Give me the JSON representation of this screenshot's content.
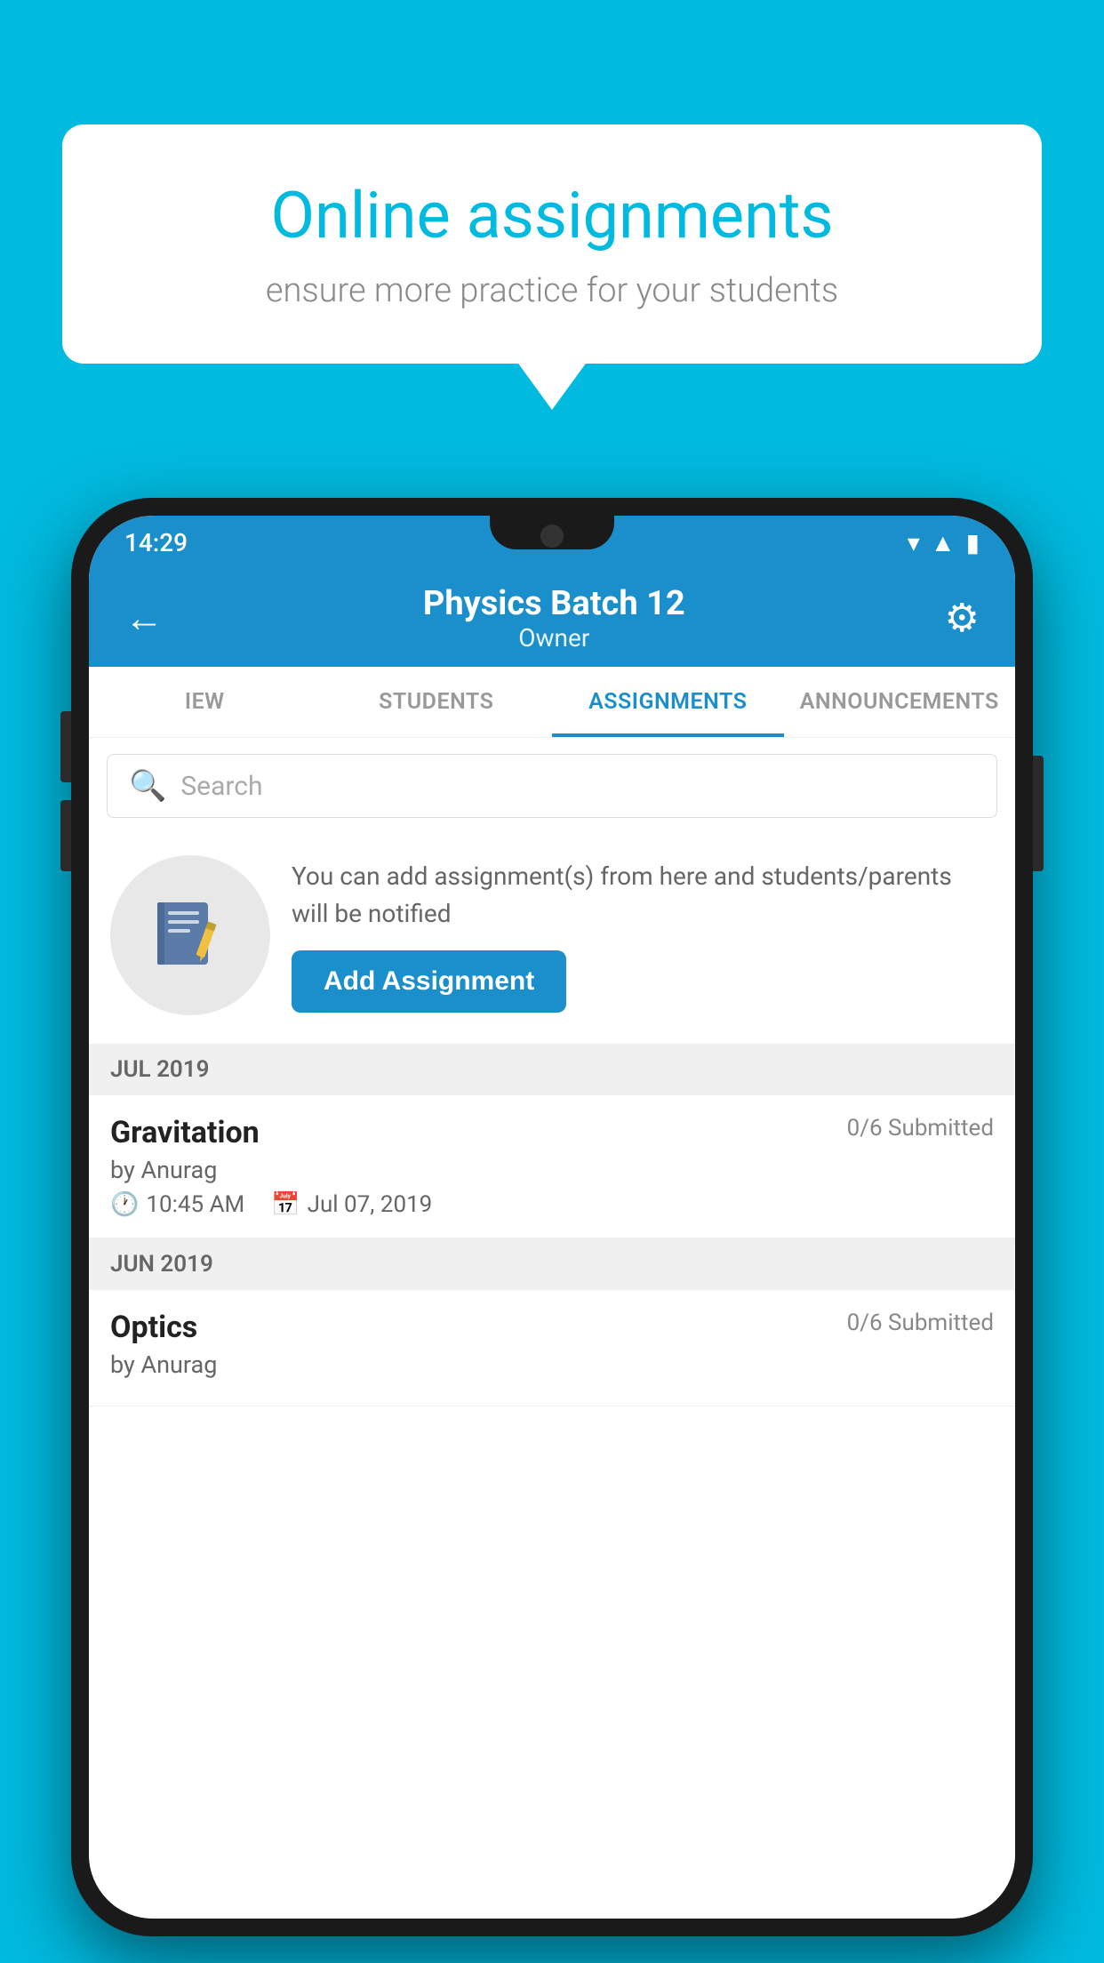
{
  "background_color": "#00BADF",
  "speech_bubble": {
    "title": "Online assignments",
    "subtitle": "ensure more practice for your students"
  },
  "status_bar": {
    "time": "14:29",
    "icons": [
      "wifi",
      "signal",
      "battery"
    ]
  },
  "app_bar": {
    "title": "Physics Batch 12",
    "subtitle": "Owner",
    "back_label": "←",
    "settings_label": "⚙"
  },
  "tabs": [
    {
      "label": "IEW",
      "active": false
    },
    {
      "label": "STUDENTS",
      "active": false
    },
    {
      "label": "ASSIGNMENTS",
      "active": true
    },
    {
      "label": "ANNOUNCEMENTS",
      "active": false
    }
  ],
  "search": {
    "placeholder": "Search"
  },
  "promo": {
    "description": "You can add assignment(s) from here and students/parents will be notified",
    "button_label": "Add Assignment"
  },
  "sections": [
    {
      "header": "JUL 2019",
      "assignments": [
        {
          "title": "Gravitation",
          "submitted": "0/6 Submitted",
          "by": "by Anurag",
          "time": "10:45 AM",
          "date": "Jul 07, 2019"
        }
      ]
    },
    {
      "header": "JUN 2019",
      "assignments": [
        {
          "title": "Optics",
          "submitted": "0/6 Submitted",
          "by": "by Anurag",
          "time": "",
          "date": ""
        }
      ]
    }
  ]
}
